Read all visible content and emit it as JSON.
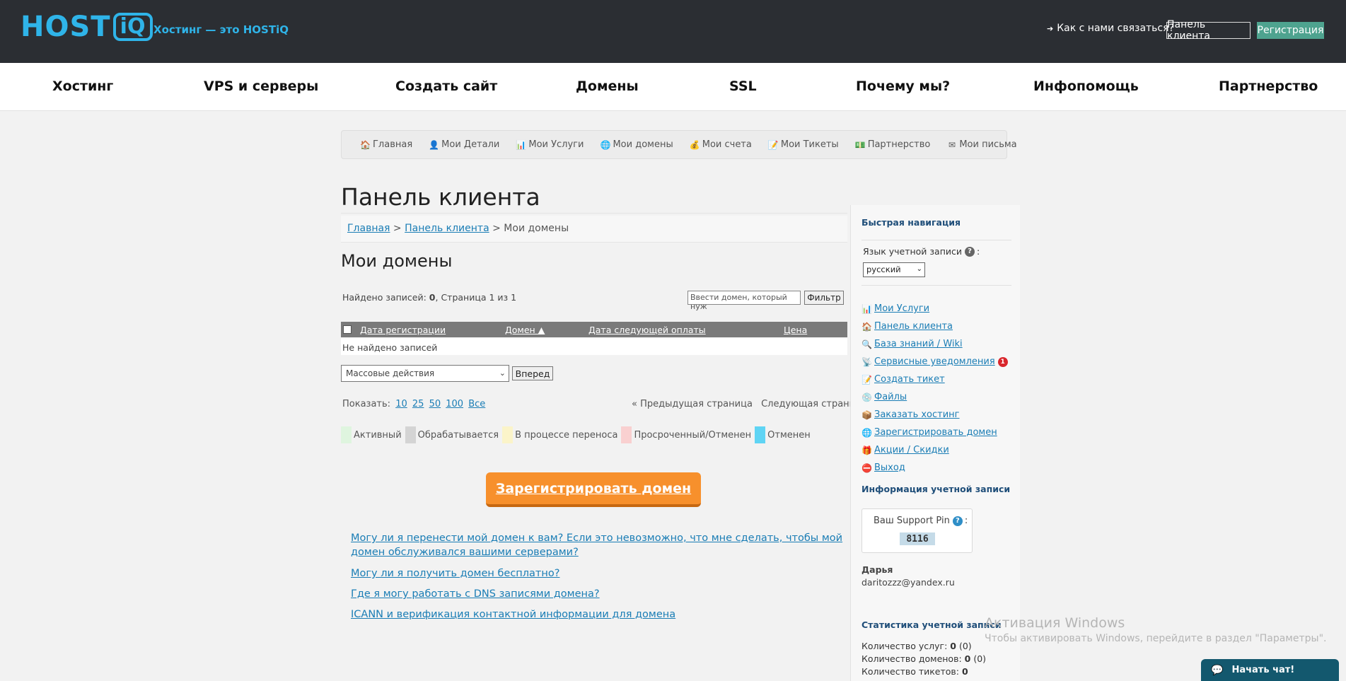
{
  "header": {
    "logo_host": "HOST",
    "logo_iq": "iQ",
    "tagline": "Хостинг — это HOSTiQ",
    "contact": "Как с нами связаться?",
    "client_panel": "Панель клиента",
    "register": "Регистрация"
  },
  "mainnav": [
    "Хостинг",
    "VPS и серверы",
    "Создать сайт",
    "Домены",
    "SSL",
    "Почему мы?",
    "Инфопомощь",
    "Партнерство"
  ],
  "subnav": [
    {
      "label": "Главная",
      "icon": "house-icon",
      "glyph": "🏠"
    },
    {
      "label": "Мои Детали",
      "icon": "user-icon",
      "glyph": "👤"
    },
    {
      "label": "Мои Услуги",
      "icon": "bar-chart-icon",
      "glyph": "📊"
    },
    {
      "label": "Мои домены",
      "icon": "globe-icon",
      "glyph": "🌐"
    },
    {
      "label": "Мои счета",
      "icon": "coins-icon",
      "glyph": "💰"
    },
    {
      "label": "Мои Тикеты",
      "icon": "ticket-icon",
      "glyph": "📝"
    },
    {
      "label": "Партнерство",
      "icon": "money-icon",
      "glyph": "💵"
    },
    {
      "label": "Мои письма",
      "icon": "envelope-icon",
      "glyph": "✉"
    }
  ],
  "page": {
    "title": "Панель клиента",
    "breadcrumb": {
      "home": "Главная",
      "sep1": " > ",
      "panel": "Панель клиента",
      "sep2": " > ",
      "current": "Мои домены"
    },
    "subtitle": "Мои домены",
    "found_prefix": "Найдено записей: ",
    "found_count": "0",
    "found_suffix": ", Страница 1 из 1",
    "filter_placeholder": "Ввести домен, который нуж",
    "filter_button": "Фильтр",
    "table": {
      "columns": [
        "Дата регистрации",
        "Домен ▲",
        "Дата следующей оплаты",
        "Цена"
      ],
      "empty": "Не найдено записей"
    },
    "mass_actions": "Массовые действия",
    "go_button": "Вперед",
    "show_label": "Показать:",
    "show_options": [
      "10",
      "25",
      "50",
      "100",
      "Все"
    ],
    "prev_page": "« Предыдущая страница",
    "next_page": "Следующая страница »",
    "legend": [
      {
        "label": "Активный",
        "color": "#dff5df"
      },
      {
        "label": "Обрабатывается",
        "color": "#d4d4d4"
      },
      {
        "label": "В процессе переноса",
        "color": "#fbf4c9"
      },
      {
        "label": "Просроченный/Отменен",
        "color": "#f9d0d0"
      },
      {
        "label": "Отменен",
        "color": "#5fd4f4"
      }
    ],
    "cta": "Зарегистрировать домен",
    "faq": [
      "Могу ли я перенести мой домен к вам? Если это невозможно, что мне сделать, чтобы мой домен обслуживался вашими серверами?",
      "Могу ли я получить домен бесплатно?",
      "Где я могу работать с DNS записями домена?",
      "ICANN и верификация контактной информации для домена"
    ]
  },
  "sidebar": {
    "quick_nav": "Быстрая навигация",
    "lang_label": "Язык учетной записи",
    "lang_colon": ":",
    "lang_value": "русский",
    "links": [
      {
        "label": "Мои Услуги",
        "icon": "bar-chart-icon",
        "glyph": "📊"
      },
      {
        "label": "Панель клиента",
        "icon": "house-icon",
        "glyph": "🏠"
      },
      {
        "label": "База знаний / Wiki",
        "icon": "magnifier-icon",
        "glyph": "🔍"
      },
      {
        "label": "Сервисные уведомления",
        "icon": "antenna-icon",
        "glyph": "📡",
        "badge": "1"
      },
      {
        "label": "Создать тикет",
        "icon": "note-icon",
        "glyph": "📝"
      },
      {
        "label": "Файлы",
        "icon": "disc-icon",
        "glyph": "💿"
      },
      {
        "label": "Заказать хостинг",
        "icon": "box-icon",
        "glyph": "📦"
      },
      {
        "label": "Зарегистрировать домен",
        "icon": "globe-icon",
        "glyph": "🌐"
      },
      {
        "label": "Акции / Скидки",
        "icon": "gift-icon",
        "glyph": "🎁"
      },
      {
        "label": "Выход",
        "icon": "exit-icon",
        "glyph": "⛔"
      }
    ],
    "account_info": "Информация учетной записи",
    "pin_label": "Ваш Support Pin",
    "pin_colon": ":",
    "pin_value": "8116",
    "user_name": "Дарья",
    "user_email": "daritozzz@yandex.ru",
    "stats_title": "Статистика учетной записи",
    "stats": [
      {
        "label": "Количество услуг: ",
        "value": "0",
        "extra": " (0)"
      },
      {
        "label": "Количество доменов: ",
        "value": "0",
        "extra": " (0)"
      },
      {
        "label": "Количество тикетов: ",
        "value": "0",
        "extra": ""
      }
    ]
  },
  "watermark": {
    "title": "Активация Windows",
    "text": "Чтобы активировать Windows, перейдите в раздел \"Параметры\"."
  },
  "chat": {
    "label": "Начать чат!"
  }
}
